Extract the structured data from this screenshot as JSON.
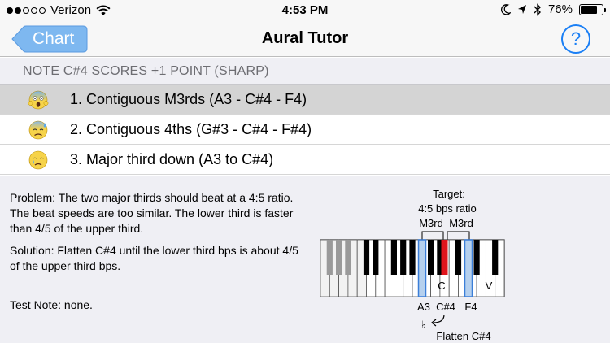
{
  "status_bar": {
    "carrier": "Verizon",
    "time": "4:53 PM",
    "battery": "76%",
    "battery_level": 0.76,
    "icons": [
      "signal-icon",
      "wifi-icon",
      "moon-icon",
      "location-icon",
      "bluetooth-icon",
      "battery-icon"
    ]
  },
  "nav": {
    "back_label": "Chart",
    "title": "Aural Tutor",
    "help_label": "?"
  },
  "section_header": "NOTE C#4 SCORES +1 POINT (SHARP)",
  "list": [
    {
      "label": "1. Contiguous M3rds (A3 - C#4 - F4)",
      "emoji": "screaming-face-icon",
      "selected": true
    },
    {
      "label": "2. Contiguous 4ths (G#3 - C#4 - F#4)",
      "emoji": "anxious-sweat-face-icon",
      "selected": false
    },
    {
      "label": "3. Major third down (A3 to C#4)",
      "emoji": "crying-face-icon",
      "selected": false
    }
  ],
  "info": {
    "problem": "Problem: The two major thirds should beat at a 4:5 ratio. The beat speeds are too similar. The lower third is faster than 4/5 of the upper third.",
    "solution": "Solution: Flatten C#4 until the lower third bps is about 4/5 of the upper third bps.",
    "test_note": "Test Note: none."
  },
  "diagram": {
    "target_label": "Target:",
    "ratio_label": "4:5 bps ratio",
    "interval_left": "M3rd",
    "interval_right": "M3rd",
    "key_c_label": "C",
    "key_mark_label": "V",
    "note_a3": "A3",
    "note_cs4": "C#4",
    "note_f4": "F4",
    "flat_symbol": "♭",
    "flatten_label": "Flatten C#4",
    "colors": {
      "highlight": "#b5d0ee",
      "highlight_border": "#3b7ed8",
      "target_key": "#e0141c"
    }
  }
}
